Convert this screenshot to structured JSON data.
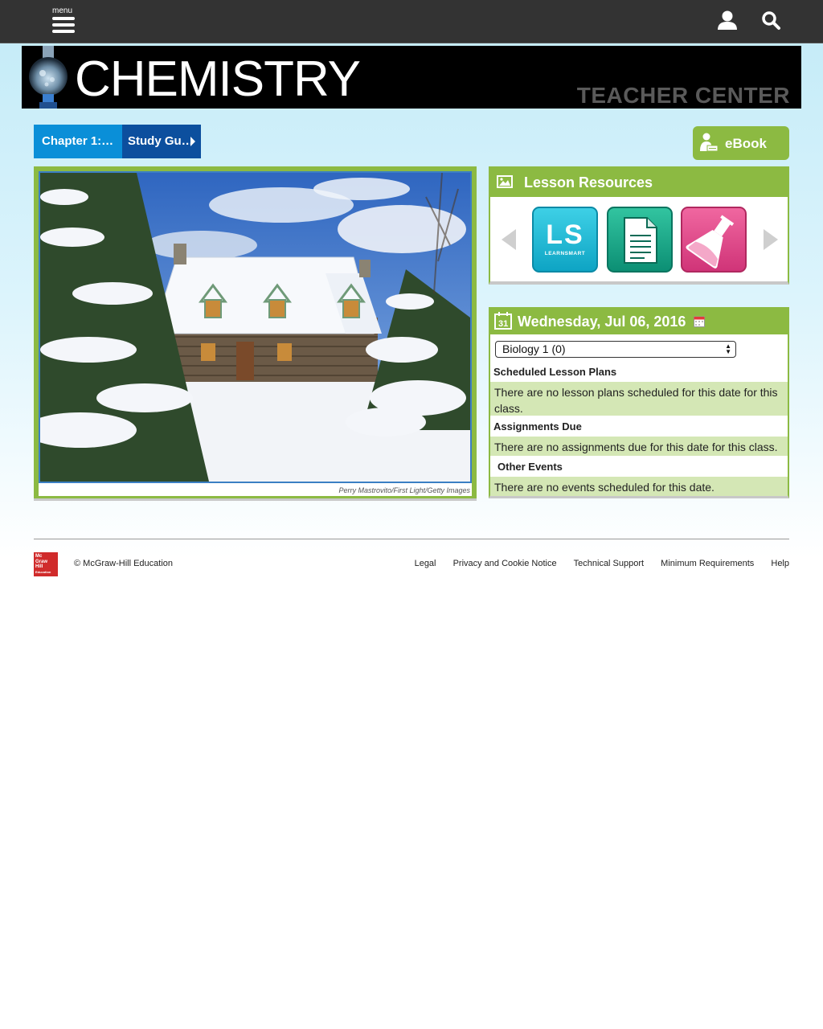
{
  "topbar": {
    "menu_label": "menu"
  },
  "banner": {
    "title": "CHEMISTRY",
    "subtitle": "TEACHER CENTER"
  },
  "breadcrumb": {
    "items": [
      "Chapter 1:…",
      "Study Gu…"
    ]
  },
  "ebook": {
    "label": "eBook"
  },
  "image": {
    "credit": "Perry Mastrovito/First Light/Getty Images"
  },
  "resources": {
    "title": "Lesson Resources",
    "learnsmart_text": "LS",
    "learnsmart_sub": "LEARNSMART"
  },
  "calendar": {
    "date": "Wednesday, Jul 06, 2016",
    "class_select_value": "Biology 1 (0)",
    "sections": [
      {
        "label": "Scheduled Lesson Plans",
        "message": "There are no lesson plans scheduled for this date for this class."
      },
      {
        "label": "Assignments Due",
        "message": "There are no assignments due for this date for this class."
      },
      {
        "label": "Other Events",
        "message": "There are no events scheduled for this date."
      }
    ]
  },
  "footer": {
    "logo_text": [
      "Mc",
      "Graw",
      "Hill",
      "Education"
    ],
    "copyright": "© McGraw-Hill Education",
    "links": [
      "Legal",
      "Privacy and Cookie Notice",
      "Technical Support",
      "Minimum Requirements",
      "Help"
    ]
  },
  "colors": {
    "topbar": "#333333",
    "accent_green": "#8cba42",
    "breadcrumb_light": "#0a8fd8",
    "breadcrumb_dark": "#0c4f9e",
    "message_bg": "#d4e7b5"
  },
  "icons": [
    "menu-icon",
    "user-icon",
    "search-icon",
    "flask-logo",
    "ebook-reader-icon",
    "image-icon",
    "arrow-left-icon",
    "arrow-right-icon",
    "learnsmart-icon",
    "document-icon",
    "lab-flask-icon",
    "calendar-icon",
    "mini-calendar-icon"
  ]
}
